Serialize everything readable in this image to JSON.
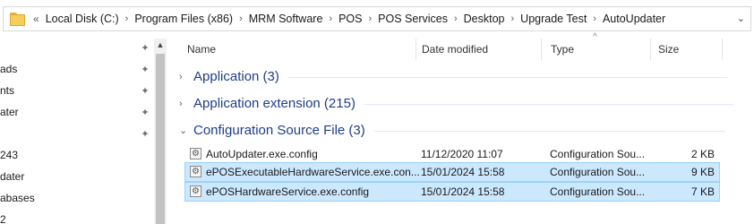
{
  "address": {
    "overflow": "«",
    "crumbs": [
      "Local Disk (C:)",
      "Program Files (x86)",
      "MRM Software",
      "POS",
      "POS Services",
      "Desktop",
      "Upgrade Test",
      "AutoUpdater"
    ],
    "separator": "›",
    "dropdown": "⌄"
  },
  "nav": {
    "items": [
      "ads",
      "nts",
      "ater",
      "",
      "243",
      "dater",
      "abases",
      "2"
    ],
    "pin_glyph": "📌",
    "scroll_up": "▲"
  },
  "columns": {
    "name": "Name",
    "date": "Date modified",
    "type": "Type",
    "size": "Size",
    "sort_indicator": "^"
  },
  "groups": [
    {
      "label": "Application (3)",
      "expanded": false,
      "chevron": "›"
    },
    {
      "label": "Application extension (215)",
      "expanded": false,
      "chevron": "›"
    },
    {
      "label": "Configuration Source File (3)",
      "expanded": true,
      "chevron": "⌄"
    }
  ],
  "files": [
    {
      "name": "AutoUpdater.exe.config",
      "date": "11/12/2020 11:07",
      "type": "Configuration Sou...",
      "size": "2 KB",
      "selected": false
    },
    {
      "name": "ePOSExecutableHardwareService.exe.con...",
      "date": "15/01/2024 15:58",
      "type": "Configuration Sou...",
      "size": "9 KB",
      "selected": true
    },
    {
      "name": "ePOSHardwareService.exe.config",
      "date": "15/01/2024 15:58",
      "type": "Configuration Sou...",
      "size": "7 KB",
      "selected": true
    }
  ],
  "colors": {
    "group_label": "#1e3e87",
    "selection_bg": "#cce8ff",
    "selection_border": "#99d1ff"
  }
}
